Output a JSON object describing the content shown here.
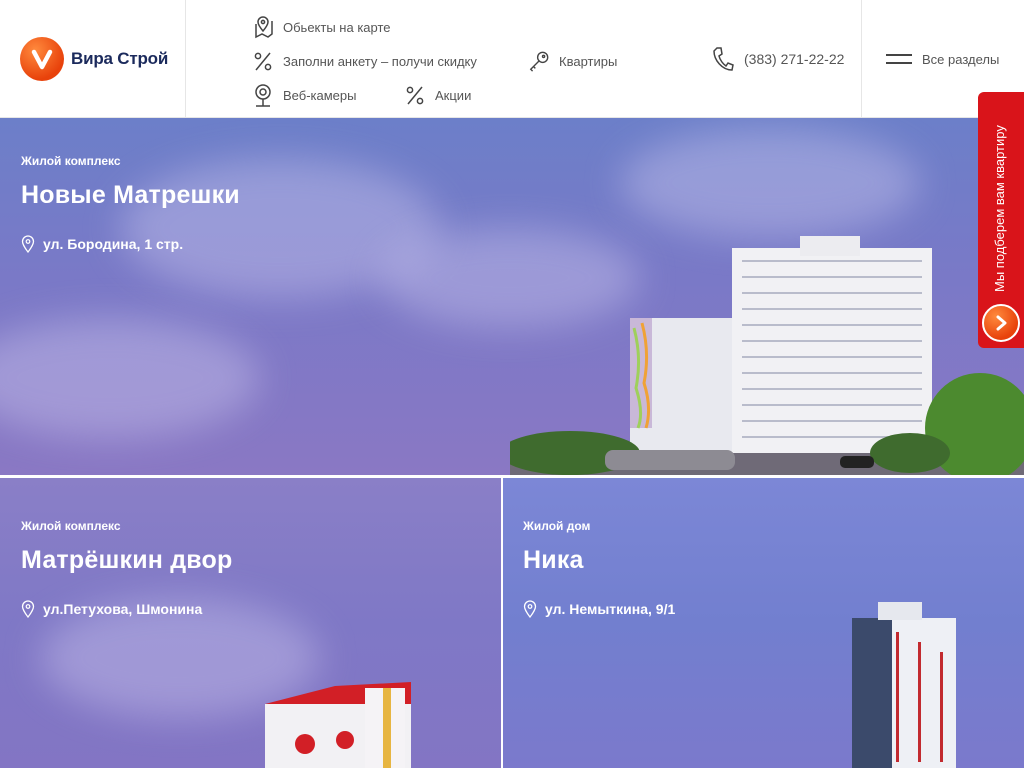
{
  "brand": {
    "name": "Вира Строй",
    "accent": "#e8420b"
  },
  "nav": {
    "map": "Обьекты на карте",
    "survey": "Заполни анкету – получи скидку",
    "apartments": "Квартиры",
    "webcams": "Веб-камеры",
    "promos": "Акции"
  },
  "phone": "(383) 271-22-22",
  "menu_label": "Все разделы",
  "side_tab": {
    "text": "Мы подберем вам квартиру",
    "color": "#d9141a"
  },
  "cards": [
    {
      "kind": "Жилой комплекс",
      "title": "Новые Матрешки",
      "address": "ул. Бородина, 1 стр."
    },
    {
      "kind": "Жилой комплекс",
      "title": "Матрёшкин двор",
      "address": "ул.Петухова, Шмонина"
    },
    {
      "kind": "Жилой дом",
      "title": "Ника",
      "address": "ул. Немыткина, 9/1"
    }
  ]
}
